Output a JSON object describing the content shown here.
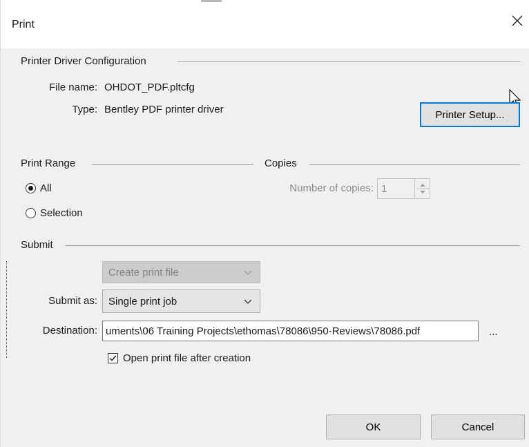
{
  "window": {
    "title": "Print"
  },
  "printer_driver": {
    "heading": "Printer Driver Configuration",
    "file_name_label": "File name:",
    "file_name_value": "OHDOT_PDF.pltcfg",
    "type_label": "Type:",
    "type_value": "Bentley PDF printer driver",
    "setup_button": "Printer Setup..."
  },
  "print_range": {
    "heading": "Print Range",
    "options": [
      {
        "label": "All",
        "selected": true
      },
      {
        "label": "Selection",
        "selected": false
      }
    ]
  },
  "copies": {
    "heading": "Copies",
    "label": "Number of copies:",
    "value": "1"
  },
  "submit": {
    "heading": "Submit",
    "mode": "Create print file",
    "submit_as_label": "Submit as:",
    "submit_as_value": "Single print job",
    "destination_label": "Destination:",
    "destination_value": "uments\\06 Training Projects\\ethomas\\78086\\950-Reviews\\78086.pdf",
    "browse_label": "...",
    "open_after_label": "Open print file after creation",
    "open_after_checked": true
  },
  "footer": {
    "ok": "OK",
    "cancel": "Cancel"
  },
  "icons": [
    "close-icon",
    "mouse-cursor-icon",
    "chevron-down-icon",
    "spin-up-icon",
    "spin-down-icon",
    "check-icon"
  ],
  "colors": {
    "focus_border": "#0078d7",
    "dialog_bg": "#f0f0f0",
    "titlebar_bg": "#ffffff"
  }
}
